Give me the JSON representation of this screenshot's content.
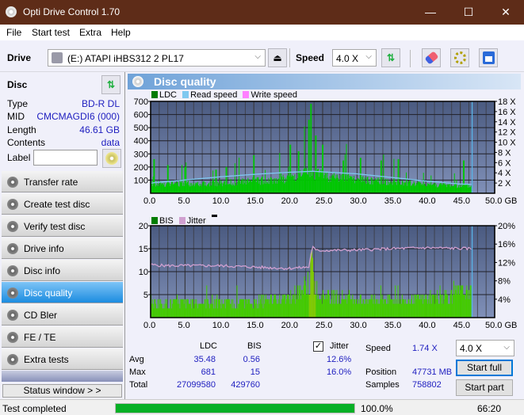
{
  "window": {
    "title": "Opti Drive Control 1.70",
    "minimize": "—",
    "maximize": "☐",
    "close": "✕"
  },
  "menu": [
    "File",
    "Start test",
    "Extra",
    "Help"
  ],
  "toolbar": {
    "drive_label": "Drive",
    "drive_value": "(E:)  ATAPI iHBS312   2 PL17",
    "speed_label": "Speed",
    "speed_value": "4.0 X"
  },
  "disc": {
    "header": "Disc",
    "rows": [
      {
        "key": "Type",
        "value": "BD-R DL"
      },
      {
        "key": "MID",
        "value": "CMCMAGDI6 (000)"
      },
      {
        "key": "Length",
        "value": "46.61 GB"
      },
      {
        "key": "Contents",
        "value": "data"
      }
    ],
    "label_key": "Label",
    "label_value": ""
  },
  "nav": [
    {
      "label": "Transfer rate",
      "active": false
    },
    {
      "label": "Create test disc",
      "active": false
    },
    {
      "label": "Verify test disc",
      "active": false
    },
    {
      "label": "Drive info",
      "active": false
    },
    {
      "label": "Disc info",
      "active": false
    },
    {
      "label": "Disc quality",
      "active": true
    },
    {
      "label": "CD Bler",
      "active": false
    },
    {
      "label": "FE / TE",
      "active": false
    },
    {
      "label": "Extra tests",
      "active": false
    }
  ],
  "status_window_label": "Status window > >",
  "panel_title": "Disc quality",
  "colors": {
    "ldc": "#007c00",
    "read": "#7ec8f0",
    "write": "#ff80ff",
    "bis": "#007c00",
    "jitter": "#d0a0d0",
    "bar": "#00cc00",
    "accent": "#0078d7",
    "progress": "#06b025"
  },
  "chart_data": [
    {
      "type": "bar",
      "title": "LDC",
      "legend": [
        "LDC",
        "Read speed",
        "Write speed"
      ],
      "xlabel": "GB",
      "x_ticks": [
        "0.0",
        "5.0",
        "10.0",
        "15.0",
        "20.0",
        "25.0",
        "30.0",
        "35.0",
        "40.0",
        "45.0",
        "50.0 GB"
      ],
      "y_ticks": [
        "100",
        "200",
        "300",
        "400",
        "500",
        "600",
        "700"
      ],
      "y2_ticks": [
        "2 X",
        "4 X",
        "6 X",
        "8 X",
        "10 X",
        "12 X",
        "14 X",
        "16 X",
        "18 X"
      ],
      "xlim": [
        0,
        50
      ],
      "ylim": [
        0,
        700
      ],
      "y2lim": [
        0,
        18
      ],
      "disc_end_gb": 46.61,
      "ldc_peaks": [
        [
          0.5,
          260
        ],
        [
          2.5,
          215
        ],
        [
          5.0,
          200
        ],
        [
          9.5,
          180
        ],
        [
          11.0,
          200
        ],
        [
          15.0,
          290
        ],
        [
          20.3,
          370
        ],
        [
          21.5,
          320
        ],
        [
          23.0,
          560
        ],
        [
          23.3,
          681
        ],
        [
          24.0,
          440
        ],
        [
          25.0,
          370
        ],
        [
          28.0,
          250
        ],
        [
          30.5,
          270
        ],
        [
          33.5,
          250
        ],
        [
          36.0,
          260
        ],
        [
          45.5,
          250
        ]
      ],
      "ldc_baseline": [
        [
          0,
          80
        ],
        [
          10,
          85
        ],
        [
          20,
          120
        ],
        [
          23,
          170
        ],
        [
          26,
          140
        ],
        [
          35,
          90
        ],
        [
          46.6,
          60
        ]
      ],
      "read_speed": [
        [
          0,
          2.0
        ],
        [
          5,
          2.6
        ],
        [
          10,
          3.2
        ],
        [
          15,
          3.7
        ],
        [
          20,
          4.1
        ],
        [
          23.5,
          4.3
        ],
        [
          30,
          3.8
        ],
        [
          35,
          3.1
        ],
        [
          40,
          2.4
        ],
        [
          45,
          1.8
        ],
        [
          46.6,
          1.74
        ]
      ]
    },
    {
      "type": "bar",
      "title": "BIS",
      "legend": [
        "BIS",
        "Jitter"
      ],
      "xlabel": "GB",
      "x_ticks": [
        "0.0",
        "5.0",
        "10.0",
        "15.0",
        "20.0",
        "25.0",
        "30.0",
        "35.0",
        "40.0",
        "45.0",
        "50.0 GB"
      ],
      "y_ticks": [
        "5",
        "10",
        "15",
        "20"
      ],
      "y2_ticks": [
        "4%",
        "8%",
        "12%",
        "16%",
        "20%"
      ],
      "xlim": [
        0,
        50
      ],
      "ylim": [
        0,
        20
      ],
      "y2lim": [
        0,
        20
      ],
      "disc_end_gb": 46.61,
      "bis_levels": [
        [
          0,
          4
        ],
        [
          5,
          4
        ],
        [
          10,
          4
        ],
        [
          15,
          4
        ],
        [
          20,
          5
        ],
        [
          23,
          9
        ],
        [
          23.5,
          13
        ],
        [
          24,
          6
        ],
        [
          30,
          5
        ],
        [
          40,
          5
        ],
        [
          46,
          7
        ]
      ],
      "jitter_pct": [
        [
          0,
          11.5
        ],
        [
          2,
          11.3
        ],
        [
          10,
          11.3
        ],
        [
          15,
          11.0
        ],
        [
          20,
          10.7
        ],
        [
          23,
          11.0
        ],
        [
          23.5,
          15.5
        ],
        [
          24,
          14.6
        ],
        [
          30,
          14.7
        ],
        [
          35,
          15.0
        ],
        [
          40,
          15.2
        ],
        [
          46.6,
          15.0
        ]
      ]
    }
  ],
  "stats": {
    "col_ldc": "LDC",
    "col_bis": "BIS",
    "avg_label": "Avg",
    "max_label": "Max",
    "total_label": "Total",
    "ldc_avg": "35.48",
    "ldc_max": "681",
    "ldc_total": "27099580",
    "bis_avg": "0.56",
    "bis_max": "15",
    "bis_total": "429760",
    "jitter_label": "Jitter",
    "jitter_checked": true,
    "jitter_avg": "12.6%",
    "jitter_max": "16.0%",
    "speed_label": "Speed",
    "speed_value": "1.74 X",
    "position_label": "Position",
    "position_value": "47731 MB",
    "samples_label": "Samples",
    "samples_value": "758802",
    "speed_select": "4.0 X",
    "start_full": "Start full",
    "start_part": "Start part"
  },
  "statusbar": {
    "text": "Test completed",
    "progress": 100.0,
    "progress_text": "100.0%",
    "time": "66:20"
  }
}
